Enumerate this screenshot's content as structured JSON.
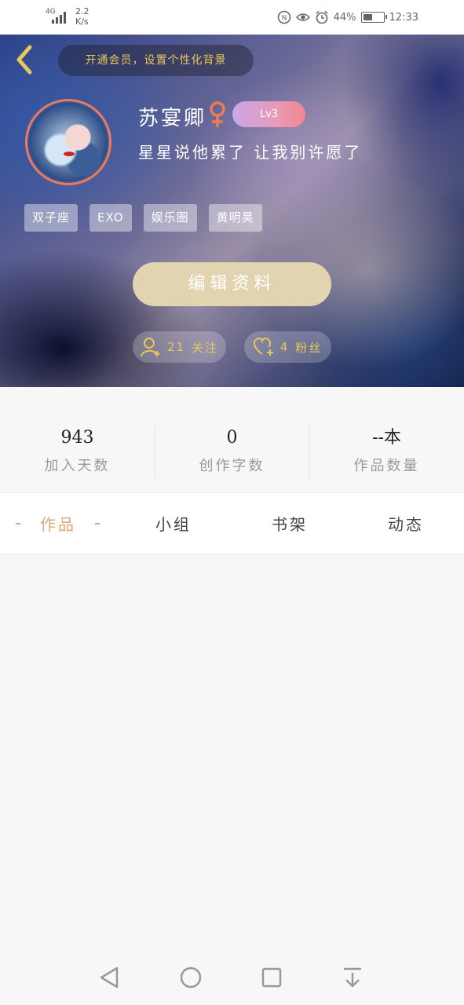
{
  "status_bar": {
    "network": "4G",
    "speed": "2.2",
    "speed_unit": "K/s",
    "battery_percent": "44%",
    "battery_level": 0.44,
    "time": "12:33"
  },
  "header": {
    "vip_banner": "开通会员，设置个性化背景",
    "username": "苏宴卿",
    "level": "Lv3",
    "bio": "星星说他累了 让我别许愿了",
    "tags": [
      "双子座",
      "EXO",
      "娱乐圈",
      "黄明昊"
    ],
    "edit_button": "编辑资料",
    "follow_count": "21",
    "follow_label": "关注",
    "fans_count": "4",
    "fans_label": "粉丝"
  },
  "stats": [
    {
      "value": "943",
      "label": "加入天数"
    },
    {
      "value": "0",
      "label": "创作字数"
    },
    {
      "value": "--本",
      "label": "作品数量"
    }
  ],
  "tabs": [
    {
      "label": "作品",
      "active": true
    },
    {
      "label": "小组",
      "active": false
    },
    {
      "label": "书架",
      "active": false
    },
    {
      "label": "动态",
      "active": false
    }
  ],
  "colors": {
    "accent_gold": "#e8c75a",
    "edit_button_bg": "#e3d4b1",
    "active_tab": "#e0a57a",
    "gender_icon": "#f07a58"
  },
  "icons": {
    "back": "chevron-left-icon",
    "gender": "female-icon",
    "follow": "add-user-icon",
    "fans": "add-heart-icon",
    "nav": [
      "back-triangle-icon",
      "home-circle-icon",
      "recents-square-icon",
      "notification-drawer-icon"
    ]
  }
}
